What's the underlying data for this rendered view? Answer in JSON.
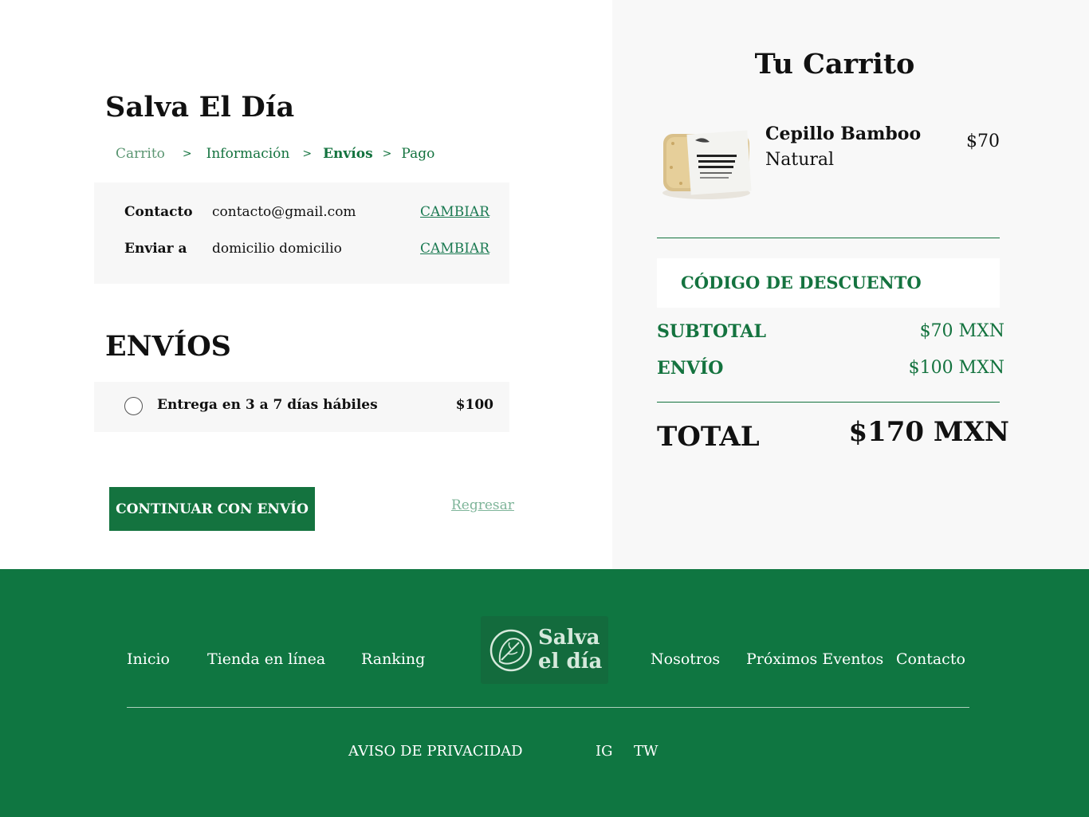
{
  "checkout": {
    "brand": "Salva El Día",
    "breadcrumb": [
      "Carrito",
      "Información",
      "Envíos",
      "Pago"
    ],
    "breadcrumb_sep": ">",
    "contact": {
      "label": "Contacto",
      "value": "contacto@gmail.com",
      "change": "CAMBIAR"
    },
    "ship_to": {
      "label": "Enviar a",
      "value": "domicilio domicilio",
      "change": "CAMBIAR"
    },
    "shipping_title": "ENVÍOS",
    "shipping_option": {
      "label": "Entrega en 3 a 7 días hábiles",
      "price": "$100",
      "selected": false
    },
    "continue_label": "CONTINUAR CON ENVÍO",
    "back_label": "Regresar"
  },
  "cart": {
    "title": "Tu Carrito",
    "item": {
      "name": "Cepillo Bamboo",
      "variant": "Natural",
      "price": "$70",
      "image": "bamboo-brush-package"
    },
    "discount_label": "CÓDIGO DE DESCUENTO",
    "subtotal_label": "SUBTOTAL",
    "subtotal_value": "$70 MXN",
    "shipping_label": "ENVÍO",
    "shipping_value": "$100 MXN",
    "total_label": "TOTAL",
    "total_value": "$170 MXN"
  },
  "footer": {
    "nav": [
      "Inicio",
      "Tienda en línea",
      "Ranking",
      "Nosotros",
      "Próximos Eventos",
      "Contacto"
    ],
    "logo_text_line1": "Salva",
    "logo_text_line2": "el día",
    "privacy": "AVISO DE PRIVACIDAD",
    "ig": "IG",
    "tw": "TW"
  },
  "colors": {
    "brand_green": "#14733f",
    "footer_green": "#0f7641",
    "panel_gray": "#f7f7f7"
  }
}
